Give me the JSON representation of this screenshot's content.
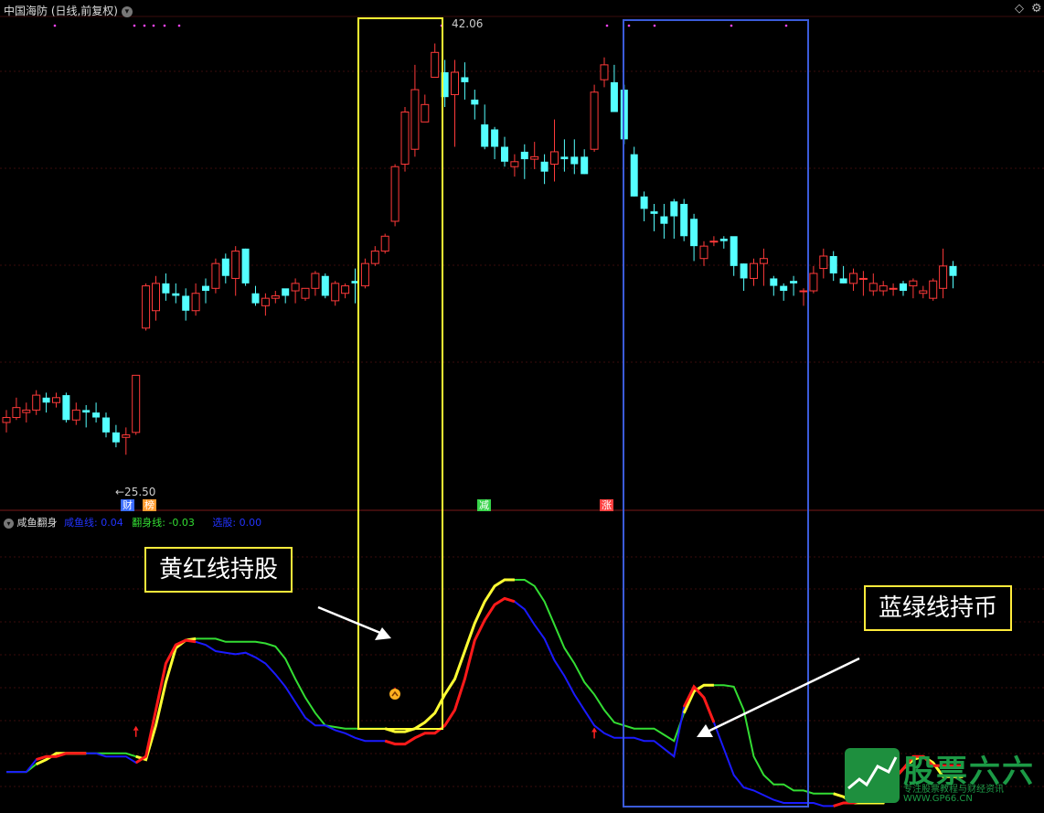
{
  "header": {
    "title": "中国海防 (日线,前复权)",
    "menu_icon": "chevron-down-icon",
    "corner_icon": "diamond-icon",
    "settings_icon": "gear-icon"
  },
  "price_labels": {
    "high": "42.06",
    "low": "←25.50"
  },
  "event_tags": [
    {
      "text": "财",
      "color": "#3a6cff"
    },
    {
      "text": "榜",
      "color": "#ff9b2f"
    },
    {
      "text": "减",
      "color": "#37d34a"
    },
    {
      "text": "涨",
      "color": "#ff4040"
    }
  ],
  "indicator": {
    "name": "咸鱼翻身",
    "items": [
      {
        "label": "咸鱼线: 0.04",
        "color": "#2233ff"
      },
      {
        "label": "翻身线: -0.03",
        "color": "#33dd33"
      },
      {
        "label": "选股: 0.00",
        "color": "#2233ff"
      }
    ]
  },
  "annotations": {
    "hold_stock": "黄红线持股",
    "hold_cash": "蓝绿线持币"
  },
  "watermark": {
    "brand": "股票六六",
    "slogan": "专注股票教程与财经资讯",
    "site": "WWW.GP66.CN"
  },
  "colors": {
    "up": "#ff3a3a",
    "down": "#54ffff",
    "yellow": "#ffff33",
    "red": "#ff1a1a",
    "blue": "#1a1aff",
    "green": "#33dd33",
    "box_yellow": "#ffff33",
    "box_blue": "#3b5bd9"
  },
  "chart_data": {
    "type": "candlestick",
    "price_ylim": [
      24,
      43
    ],
    "candles": [
      [
        26.8,
        27.0,
        26.4,
        27.3
      ],
      [
        27.0,
        27.4,
        26.9,
        27.8
      ],
      [
        27.2,
        27.3,
        26.8,
        27.6
      ],
      [
        27.3,
        27.9,
        27.1,
        28.1
      ],
      [
        27.8,
        27.6,
        27.2,
        28.0
      ],
      [
        27.6,
        27.8,
        27.4,
        28.0
      ],
      [
        27.9,
        26.9,
        26.8,
        28.0
      ],
      [
        26.9,
        27.3,
        26.7,
        27.6
      ],
      [
        27.3,
        27.2,
        26.6,
        27.5
      ],
      [
        27.2,
        27.0,
        26.8,
        27.6
      ],
      [
        27.0,
        26.4,
        26.2,
        27.2
      ],
      [
        26.4,
        26.0,
        25.8,
        26.7
      ],
      [
        26.2,
        26.3,
        25.5,
        26.6
      ],
      [
        26.4,
        28.7,
        26.3,
        28.7
      ],
      [
        30.6,
        32.3,
        30.5,
        32.4
      ],
      [
        31.3,
        32.4,
        30.9,
        32.7
      ],
      [
        32.4,
        32.0,
        31.7,
        32.8
      ],
      [
        32.0,
        31.9,
        31.6,
        32.4
      ],
      [
        31.9,
        31.3,
        30.9,
        32.2
      ],
      [
        31.3,
        32.0,
        31.1,
        32.4
      ],
      [
        32.3,
        32.1,
        31.6,
        32.6
      ],
      [
        32.2,
        33.2,
        32.0,
        33.4
      ],
      [
        33.4,
        32.7,
        32.4,
        33.6
      ],
      [
        32.6,
        33.7,
        31.9,
        33.9
      ],
      [
        33.8,
        32.4,
        32.3,
        33.8
      ],
      [
        32.0,
        31.6,
        31.5,
        32.3
      ],
      [
        31.5,
        31.8,
        31.1,
        32.0
      ],
      [
        31.8,
        31.9,
        31.6,
        32.1
      ],
      [
        32.2,
        31.9,
        31.6,
        32.1
      ],
      [
        32.1,
        32.4,
        31.6,
        32.6
      ],
      [
        31.8,
        32.2,
        31.7,
        32.2
      ],
      [
        32.2,
        32.8,
        31.9,
        32.9
      ],
      [
        32.7,
        31.9,
        31.8,
        32.8
      ],
      [
        31.7,
        32.4,
        31.5,
        32.5
      ],
      [
        32.0,
        32.3,
        31.8,
        32.4
      ],
      [
        32.5,
        32.4,
        31.6,
        33.0
      ],
      [
        32.3,
        33.2,
        32.2,
        33.4
      ],
      [
        33.2,
        33.7,
        33.1,
        33.9
      ],
      [
        33.7,
        34.3,
        33.6,
        34.4
      ],
      [
        34.9,
        37.1,
        34.7,
        37.2
      ],
      [
        37.2,
        39.3,
        36.9,
        39.5
      ],
      [
        37.8,
        40.2,
        37.5,
        41.2
      ],
      [
        38.9,
        39.6,
        39.5,
        40.0
      ],
      [
        40.7,
        41.7,
        40.7,
        42.06
      ],
      [
        40.9,
        39.9,
        39.5,
        41.4
      ],
      [
        40.0,
        40.9,
        37.9,
        41.4
      ],
      [
        40.7,
        40.5,
        39.8,
        41.3
      ],
      [
        39.8,
        39.6,
        39.0,
        40.2
      ],
      [
        38.8,
        37.9,
        37.8,
        39.6
      ],
      [
        38.6,
        37.9,
        37.4,
        38.7
      ],
      [
        37.9,
        37.3,
        37.1,
        38.3
      ],
      [
        37.1,
        37.3,
        36.7,
        37.6
      ],
      [
        37.7,
        37.4,
        36.6,
        38.0
      ],
      [
        37.4,
        37.5,
        37.0,
        38.1
      ],
      [
        37.3,
        36.9,
        36.4,
        37.6
      ],
      [
        37.2,
        37.7,
        36.5,
        39.0
      ],
      [
        37.5,
        37.4,
        36.9,
        38.2
      ],
      [
        37.5,
        37.2,
        36.8,
        38.2
      ],
      [
        37.5,
        36.8,
        36.8,
        37.8
      ],
      [
        37.8,
        40.1,
        37.7,
        40.4
      ],
      [
        40.6,
        41.2,
        40.3,
        41.5
      ],
      [
        40.5,
        39.3,
        39.8,
        41.2
      ],
      [
        40.2,
        38.2,
        38.0,
        40.4
      ],
      [
        37.6,
        35.9,
        35.9,
        37.9
      ],
      [
        35.9,
        35.4,
        34.9,
        36.1
      ],
      [
        35.3,
        35.2,
        34.5,
        35.6
      ],
      [
        35.1,
        34.8,
        34.2,
        35.6
      ],
      [
        35.7,
        35.1,
        34.2,
        35.8
      ],
      [
        35.6,
        34.3,
        34.1,
        35.8
      ],
      [
        35.0,
        33.9,
        33.3,
        35.2
      ],
      [
        33.4,
        33.9,
        33.1,
        34.1
      ],
      [
        34.1,
        34.1,
        33.9,
        34.3
      ],
      [
        34.2,
        34.1,
        33.8,
        34.3
      ],
      [
        34.3,
        33.1,
        32.7,
        33.4
      ],
      [
        33.2,
        32.6,
        32.1,
        33.2
      ],
      [
        32.6,
        33.2,
        32.3,
        33.4
      ],
      [
        33.2,
        33.4,
        32.3,
        33.8
      ],
      [
        32.6,
        32.3,
        31.9,
        32.7
      ],
      [
        32.3,
        32.1,
        31.7,
        32.4
      ],
      [
        32.5,
        32.4,
        31.9,
        32.7
      ],
      [
        32.1,
        32.1,
        31.5,
        32.2
      ],
      [
        32.1,
        32.8,
        32.0,
        33.1
      ],
      [
        33.0,
        33.5,
        32.6,
        33.8
      ],
      [
        33.5,
        32.8,
        32.5,
        33.7
      ],
      [
        32.6,
        32.4,
        32.4,
        33.1
      ],
      [
        32.4,
        32.8,
        32.1,
        33.0
      ],
      [
        32.6,
        32.6,
        31.9,
        32.9
      ],
      [
        32.1,
        32.4,
        31.9,
        32.8
      ],
      [
        32.1,
        32.3,
        31.9,
        32.5
      ],
      [
        32.2,
        32.2,
        31.9,
        32.4
      ],
      [
        32.4,
        32.1,
        31.9,
        32.5
      ],
      [
        32.3,
        32.5,
        31.8,
        32.6
      ],
      [
        32.0,
        32.1,
        31.8,
        32.3
      ],
      [
        31.8,
        32.5,
        31.7,
        32.6
      ],
      [
        32.2,
        33.1,
        31.8,
        33.8
      ],
      [
        33.1,
        32.7,
        32.2,
        33.3
      ]
    ],
    "indicator_ylim": [
      -0.2,
      1.5
    ],
    "series": [
      {
        "name": "咸鱼线",
        "values": [
          0.0,
          0.0,
          0.0,
          0.08,
          0.1,
          0.1,
          0.12,
          0.12,
          0.12,
          0.12,
          0.1,
          0.1,
          0.1,
          0.06,
          0.1,
          0.4,
          0.7,
          0.82,
          0.85,
          0.84,
          0.82,
          0.78,
          0.77,
          0.76,
          0.77,
          0.74,
          0.7,
          0.63,
          0.55,
          0.45,
          0.35,
          0.3,
          0.3,
          0.27,
          0.25,
          0.22,
          0.2,
          0.2,
          0.2,
          0.18,
          0.18,
          0.22,
          0.25,
          0.25,
          0.3,
          0.4,
          0.6,
          0.85,
          0.98,
          1.08,
          1.12,
          1.1,
          1.05,
          0.95,
          0.86,
          0.72,
          0.62,
          0.5,
          0.4,
          0.3,
          0.25,
          0.22,
          0.22,
          0.22,
          0.2,
          0.2,
          0.15,
          0.1,
          0.42,
          0.55,
          0.48,
          0.32,
          0.15,
          -0.02,
          -0.1,
          -0.12,
          -0.15,
          -0.18,
          -0.2,
          -0.2,
          -0.2,
          -0.2,
          -0.22,
          -0.22,
          -0.2,
          -0.2,
          -0.18,
          -0.16,
          -0.13,
          -0.05,
          0.02,
          0.1,
          0.1,
          0.04,
          0.04,
          0.04,
          0.04
        ]
      },
      {
        "name": "翻身线",
        "values": [
          0.0,
          0.0,
          0.0,
          0.05,
          0.08,
          0.12,
          0.12,
          0.12,
          0.12,
          0.12,
          0.12,
          0.12,
          0.12,
          0.1,
          0.08,
          0.3,
          0.58,
          0.8,
          0.85,
          0.86,
          0.86,
          0.86,
          0.84,
          0.84,
          0.84,
          0.84,
          0.83,
          0.81,
          0.73,
          0.6,
          0.48,
          0.38,
          0.3,
          0.29,
          0.28,
          0.28,
          0.28,
          0.28,
          0.28,
          0.26,
          0.26,
          0.28,
          0.32,
          0.38,
          0.5,
          0.6,
          0.78,
          0.96,
          1.1,
          1.2,
          1.24,
          1.24,
          1.24,
          1.2,
          1.1,
          0.95,
          0.8,
          0.7,
          0.58,
          0.5,
          0.4,
          0.32,
          0.3,
          0.28,
          0.28,
          0.28,
          0.24,
          0.2,
          0.38,
          0.52,
          0.56,
          0.56,
          0.56,
          0.55,
          0.4,
          0.1,
          -0.02,
          -0.08,
          -0.08,
          -0.12,
          -0.12,
          -0.14,
          -0.14,
          -0.14,
          -0.16,
          -0.2,
          -0.2,
          -0.2,
          -0.2,
          -0.05,
          0.02,
          0.08,
          0.1,
          0.06,
          -0.03,
          -0.03,
          -0.03
        ]
      }
    ],
    "hold_segments": [
      [
        3,
        8
      ],
      [
        13,
        19
      ],
      [
        38,
        51
      ],
      [
        68,
        71
      ],
      [
        83,
        96
      ]
    ]
  }
}
